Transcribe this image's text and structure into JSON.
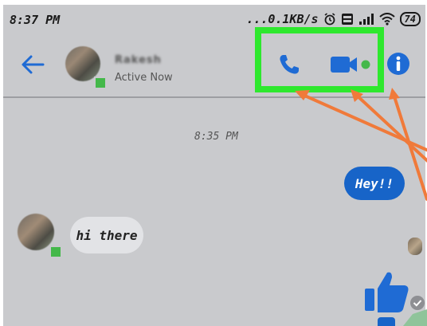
{
  "status_bar": {
    "time": "8:37 PM",
    "network_speed": "...0.1KB/s",
    "battery": "74",
    "icons": [
      "alarm-icon",
      "volte-icon",
      "signal-icon",
      "wifi-icon",
      "battery-icon"
    ]
  },
  "header": {
    "contact_name": "Rakesh",
    "active_status": "Active Now",
    "icons": [
      "back-arrow-icon",
      "phone-call-icon",
      "video-call-icon",
      "info-icon"
    ]
  },
  "conversation": {
    "timestamp": "8:35 PM",
    "sent_message": "Hey!!",
    "received_message": "hi there"
  },
  "colors": {
    "messenger_blue": "#1764c8",
    "highlight_green": "#2ee82e",
    "annotation_orange": "#f07a3a",
    "chat_background": "#c9cacd"
  }
}
